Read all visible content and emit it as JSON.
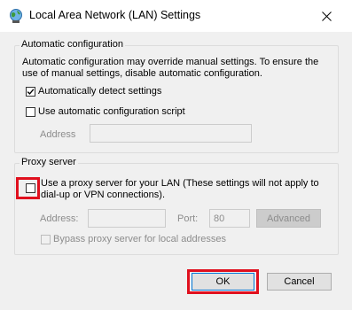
{
  "window": {
    "title": "Local Area Network (LAN) Settings",
    "icon": "globe-network-icon",
    "close_icon": "close-icon"
  },
  "auto_config": {
    "legend": "Automatic configuration",
    "description_line1": "Automatic configuration may override manual settings.  To ensure the",
    "description_line2": "use of manual settings, disable automatic configuration.",
    "auto_detect_label": "Automatically detect settings",
    "auto_detect_checked": true,
    "use_script_label": "Use automatic configuration script",
    "use_script_checked": false,
    "address_label": "Address",
    "address_value": ""
  },
  "proxy": {
    "legend": "Proxy server",
    "use_proxy_label_line1": "Use a proxy server for your LAN (These settings will not apply to",
    "use_proxy_label_line2": "dial-up or VPN connections).",
    "use_proxy_checked": false,
    "address_label": "Address:",
    "address_value": "",
    "port_label": "Port:",
    "port_value": "80",
    "advanced_label": "Advanced",
    "bypass_label": "Bypass proxy server for local addresses",
    "bypass_checked": false
  },
  "footer": {
    "ok_label": "OK",
    "cancel_label": "Cancel"
  },
  "colors": {
    "highlight": "#e0101e",
    "accent": "#0078d7"
  }
}
